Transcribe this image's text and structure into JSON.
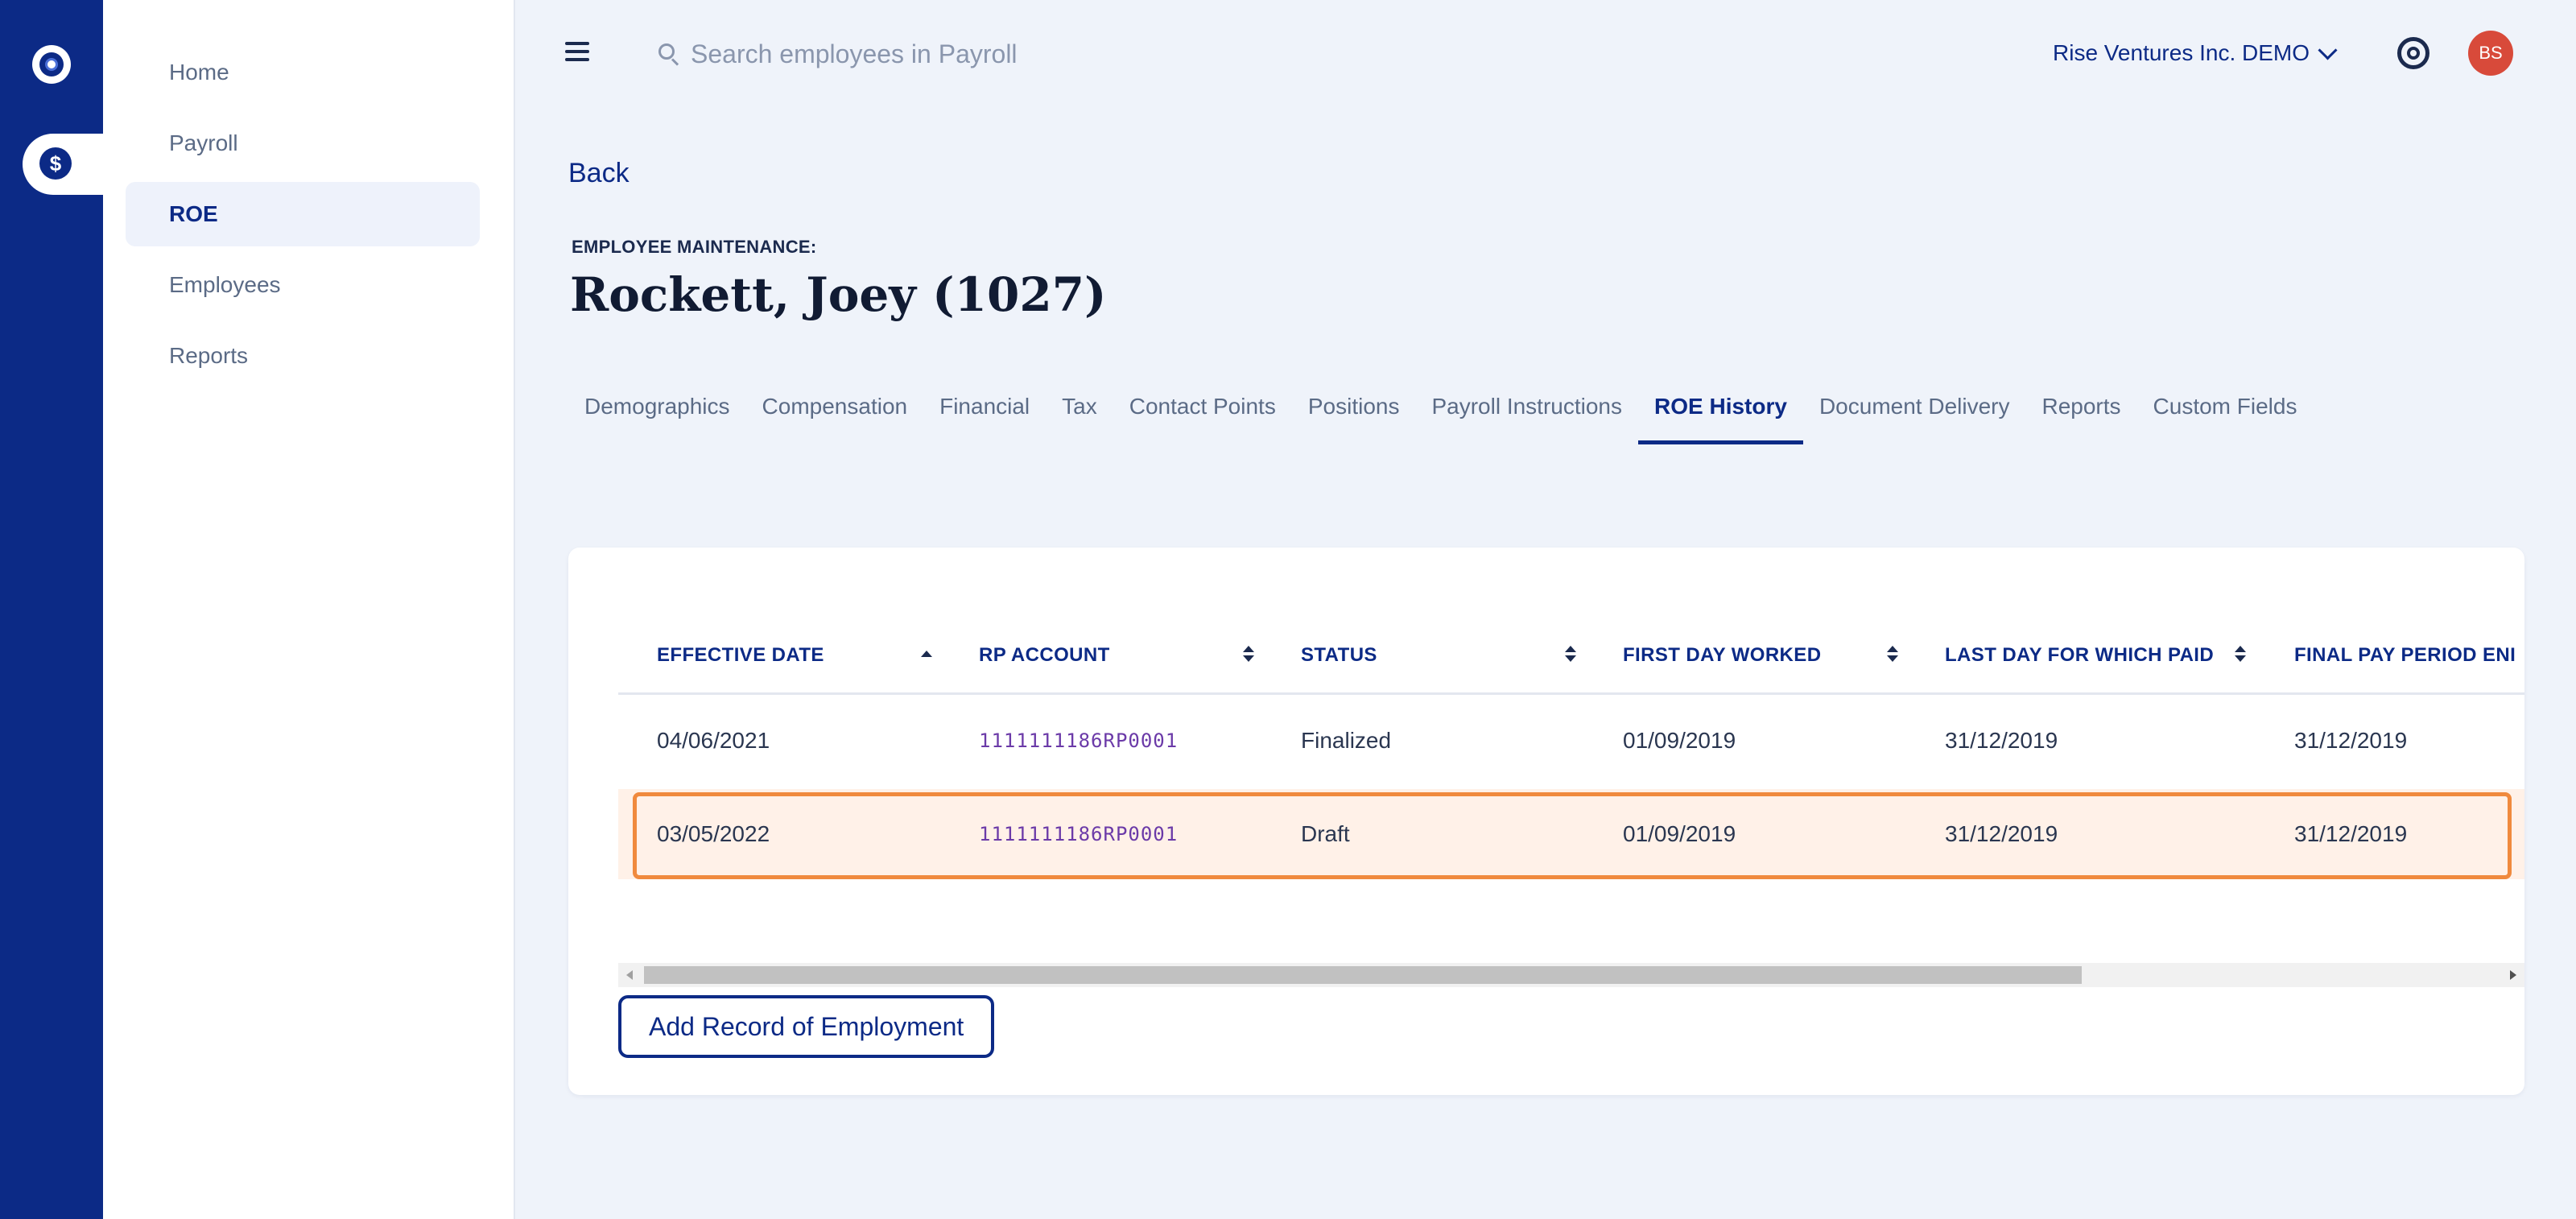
{
  "rail": {
    "logo_icon": "app-logo-icon",
    "payroll_icon": "dollar-coin-icon"
  },
  "sidebar": {
    "items": [
      {
        "label": "Home",
        "active": false
      },
      {
        "label": "Payroll",
        "active": false
      },
      {
        "label": "ROE",
        "active": true
      },
      {
        "label": "Employees",
        "active": false
      },
      {
        "label": "Reports",
        "active": false
      }
    ]
  },
  "topbar": {
    "search_placeholder": "Search employees in Payroll",
    "company": "Rise Ventures Inc. DEMO",
    "avatar_initials": "BS"
  },
  "page": {
    "back_label": "Back",
    "eyebrow": "EMPLOYEE MAINTENANCE:",
    "title": "Rockett, Joey (1027)"
  },
  "tabs": [
    {
      "label": "Demographics",
      "active": false
    },
    {
      "label": "Compensation",
      "active": false
    },
    {
      "label": "Financial",
      "active": false
    },
    {
      "label": "Tax",
      "active": false
    },
    {
      "label": "Contact Points",
      "active": false
    },
    {
      "label": "Positions",
      "active": false
    },
    {
      "label": "Payroll Instructions",
      "active": false
    },
    {
      "label": "ROE History",
      "active": true
    },
    {
      "label": "Document Delivery",
      "active": false
    },
    {
      "label": "Reports",
      "active": false
    },
    {
      "label": "Custom Fields",
      "active": false
    }
  ],
  "table": {
    "columns": [
      "EFFECTIVE DATE",
      "RP ACCOUNT",
      "STATUS",
      "FIRST DAY WORKED",
      "LAST DAY FOR WHICH PAID",
      "FINAL PAY PERIOD ENI"
    ],
    "rows": [
      [
        "04/06/2021",
        "1111111186RP0001",
        "Finalized",
        "01/09/2019",
        "31/12/2019",
        "31/12/2019"
      ],
      [
        "03/05/2022",
        "1111111186RP0001",
        "Draft",
        "01/09/2019",
        "31/12/2019",
        "31/12/2019"
      ]
    ],
    "highlighted_row": 1
  },
  "actions": {
    "add_label": "Add Record of Employment"
  },
  "colors": {
    "brand": "#0c2a86",
    "highlight_border": "#f08a3e",
    "avatar": "#d84a3a"
  }
}
